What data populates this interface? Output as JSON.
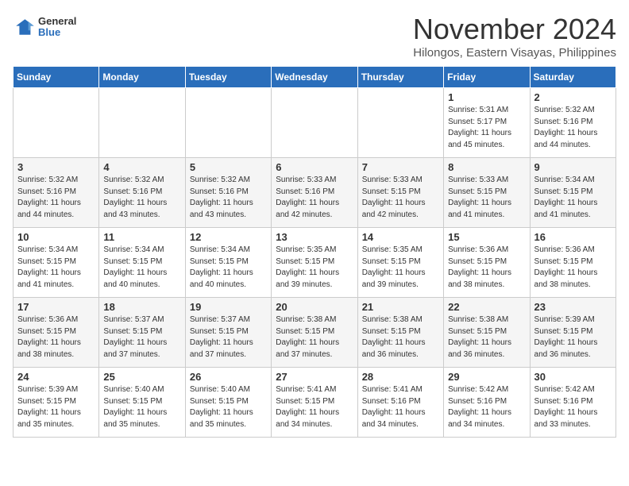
{
  "header": {
    "logo_general": "General",
    "logo_blue": "Blue",
    "month_title": "November 2024",
    "location": "Hilongos, Eastern Visayas, Philippines"
  },
  "weekdays": [
    "Sunday",
    "Monday",
    "Tuesday",
    "Wednesday",
    "Thursday",
    "Friday",
    "Saturday"
  ],
  "weeks": [
    [
      {
        "day": "",
        "info": ""
      },
      {
        "day": "",
        "info": ""
      },
      {
        "day": "",
        "info": ""
      },
      {
        "day": "",
        "info": ""
      },
      {
        "day": "",
        "info": ""
      },
      {
        "day": "1",
        "info": "Sunrise: 5:31 AM\nSunset: 5:17 PM\nDaylight: 11 hours\nand 45 minutes."
      },
      {
        "day": "2",
        "info": "Sunrise: 5:32 AM\nSunset: 5:16 PM\nDaylight: 11 hours\nand 44 minutes."
      }
    ],
    [
      {
        "day": "3",
        "info": "Sunrise: 5:32 AM\nSunset: 5:16 PM\nDaylight: 11 hours\nand 44 minutes."
      },
      {
        "day": "4",
        "info": "Sunrise: 5:32 AM\nSunset: 5:16 PM\nDaylight: 11 hours\nand 43 minutes."
      },
      {
        "day": "5",
        "info": "Sunrise: 5:32 AM\nSunset: 5:16 PM\nDaylight: 11 hours\nand 43 minutes."
      },
      {
        "day": "6",
        "info": "Sunrise: 5:33 AM\nSunset: 5:16 PM\nDaylight: 11 hours\nand 42 minutes."
      },
      {
        "day": "7",
        "info": "Sunrise: 5:33 AM\nSunset: 5:15 PM\nDaylight: 11 hours\nand 42 minutes."
      },
      {
        "day": "8",
        "info": "Sunrise: 5:33 AM\nSunset: 5:15 PM\nDaylight: 11 hours\nand 41 minutes."
      },
      {
        "day": "9",
        "info": "Sunrise: 5:34 AM\nSunset: 5:15 PM\nDaylight: 11 hours\nand 41 minutes."
      }
    ],
    [
      {
        "day": "10",
        "info": "Sunrise: 5:34 AM\nSunset: 5:15 PM\nDaylight: 11 hours\nand 41 minutes."
      },
      {
        "day": "11",
        "info": "Sunrise: 5:34 AM\nSunset: 5:15 PM\nDaylight: 11 hours\nand 40 minutes."
      },
      {
        "day": "12",
        "info": "Sunrise: 5:34 AM\nSunset: 5:15 PM\nDaylight: 11 hours\nand 40 minutes."
      },
      {
        "day": "13",
        "info": "Sunrise: 5:35 AM\nSunset: 5:15 PM\nDaylight: 11 hours\nand 39 minutes."
      },
      {
        "day": "14",
        "info": "Sunrise: 5:35 AM\nSunset: 5:15 PM\nDaylight: 11 hours\nand 39 minutes."
      },
      {
        "day": "15",
        "info": "Sunrise: 5:36 AM\nSunset: 5:15 PM\nDaylight: 11 hours\nand 38 minutes."
      },
      {
        "day": "16",
        "info": "Sunrise: 5:36 AM\nSunset: 5:15 PM\nDaylight: 11 hours\nand 38 minutes."
      }
    ],
    [
      {
        "day": "17",
        "info": "Sunrise: 5:36 AM\nSunset: 5:15 PM\nDaylight: 11 hours\nand 38 minutes."
      },
      {
        "day": "18",
        "info": "Sunrise: 5:37 AM\nSunset: 5:15 PM\nDaylight: 11 hours\nand 37 minutes."
      },
      {
        "day": "19",
        "info": "Sunrise: 5:37 AM\nSunset: 5:15 PM\nDaylight: 11 hours\nand 37 minutes."
      },
      {
        "day": "20",
        "info": "Sunrise: 5:38 AM\nSunset: 5:15 PM\nDaylight: 11 hours\nand 37 minutes."
      },
      {
        "day": "21",
        "info": "Sunrise: 5:38 AM\nSunset: 5:15 PM\nDaylight: 11 hours\nand 36 minutes."
      },
      {
        "day": "22",
        "info": "Sunrise: 5:38 AM\nSunset: 5:15 PM\nDaylight: 11 hours\nand 36 minutes."
      },
      {
        "day": "23",
        "info": "Sunrise: 5:39 AM\nSunset: 5:15 PM\nDaylight: 11 hours\nand 36 minutes."
      }
    ],
    [
      {
        "day": "24",
        "info": "Sunrise: 5:39 AM\nSunset: 5:15 PM\nDaylight: 11 hours\nand 35 minutes."
      },
      {
        "day": "25",
        "info": "Sunrise: 5:40 AM\nSunset: 5:15 PM\nDaylight: 11 hours\nand 35 minutes."
      },
      {
        "day": "26",
        "info": "Sunrise: 5:40 AM\nSunset: 5:15 PM\nDaylight: 11 hours\nand 35 minutes."
      },
      {
        "day": "27",
        "info": "Sunrise: 5:41 AM\nSunset: 5:15 PM\nDaylight: 11 hours\nand 34 minutes."
      },
      {
        "day": "28",
        "info": "Sunrise: 5:41 AM\nSunset: 5:16 PM\nDaylight: 11 hours\nand 34 minutes."
      },
      {
        "day": "29",
        "info": "Sunrise: 5:42 AM\nSunset: 5:16 PM\nDaylight: 11 hours\nand 34 minutes."
      },
      {
        "day": "30",
        "info": "Sunrise: 5:42 AM\nSunset: 5:16 PM\nDaylight: 11 hours\nand 33 minutes."
      }
    ]
  ]
}
